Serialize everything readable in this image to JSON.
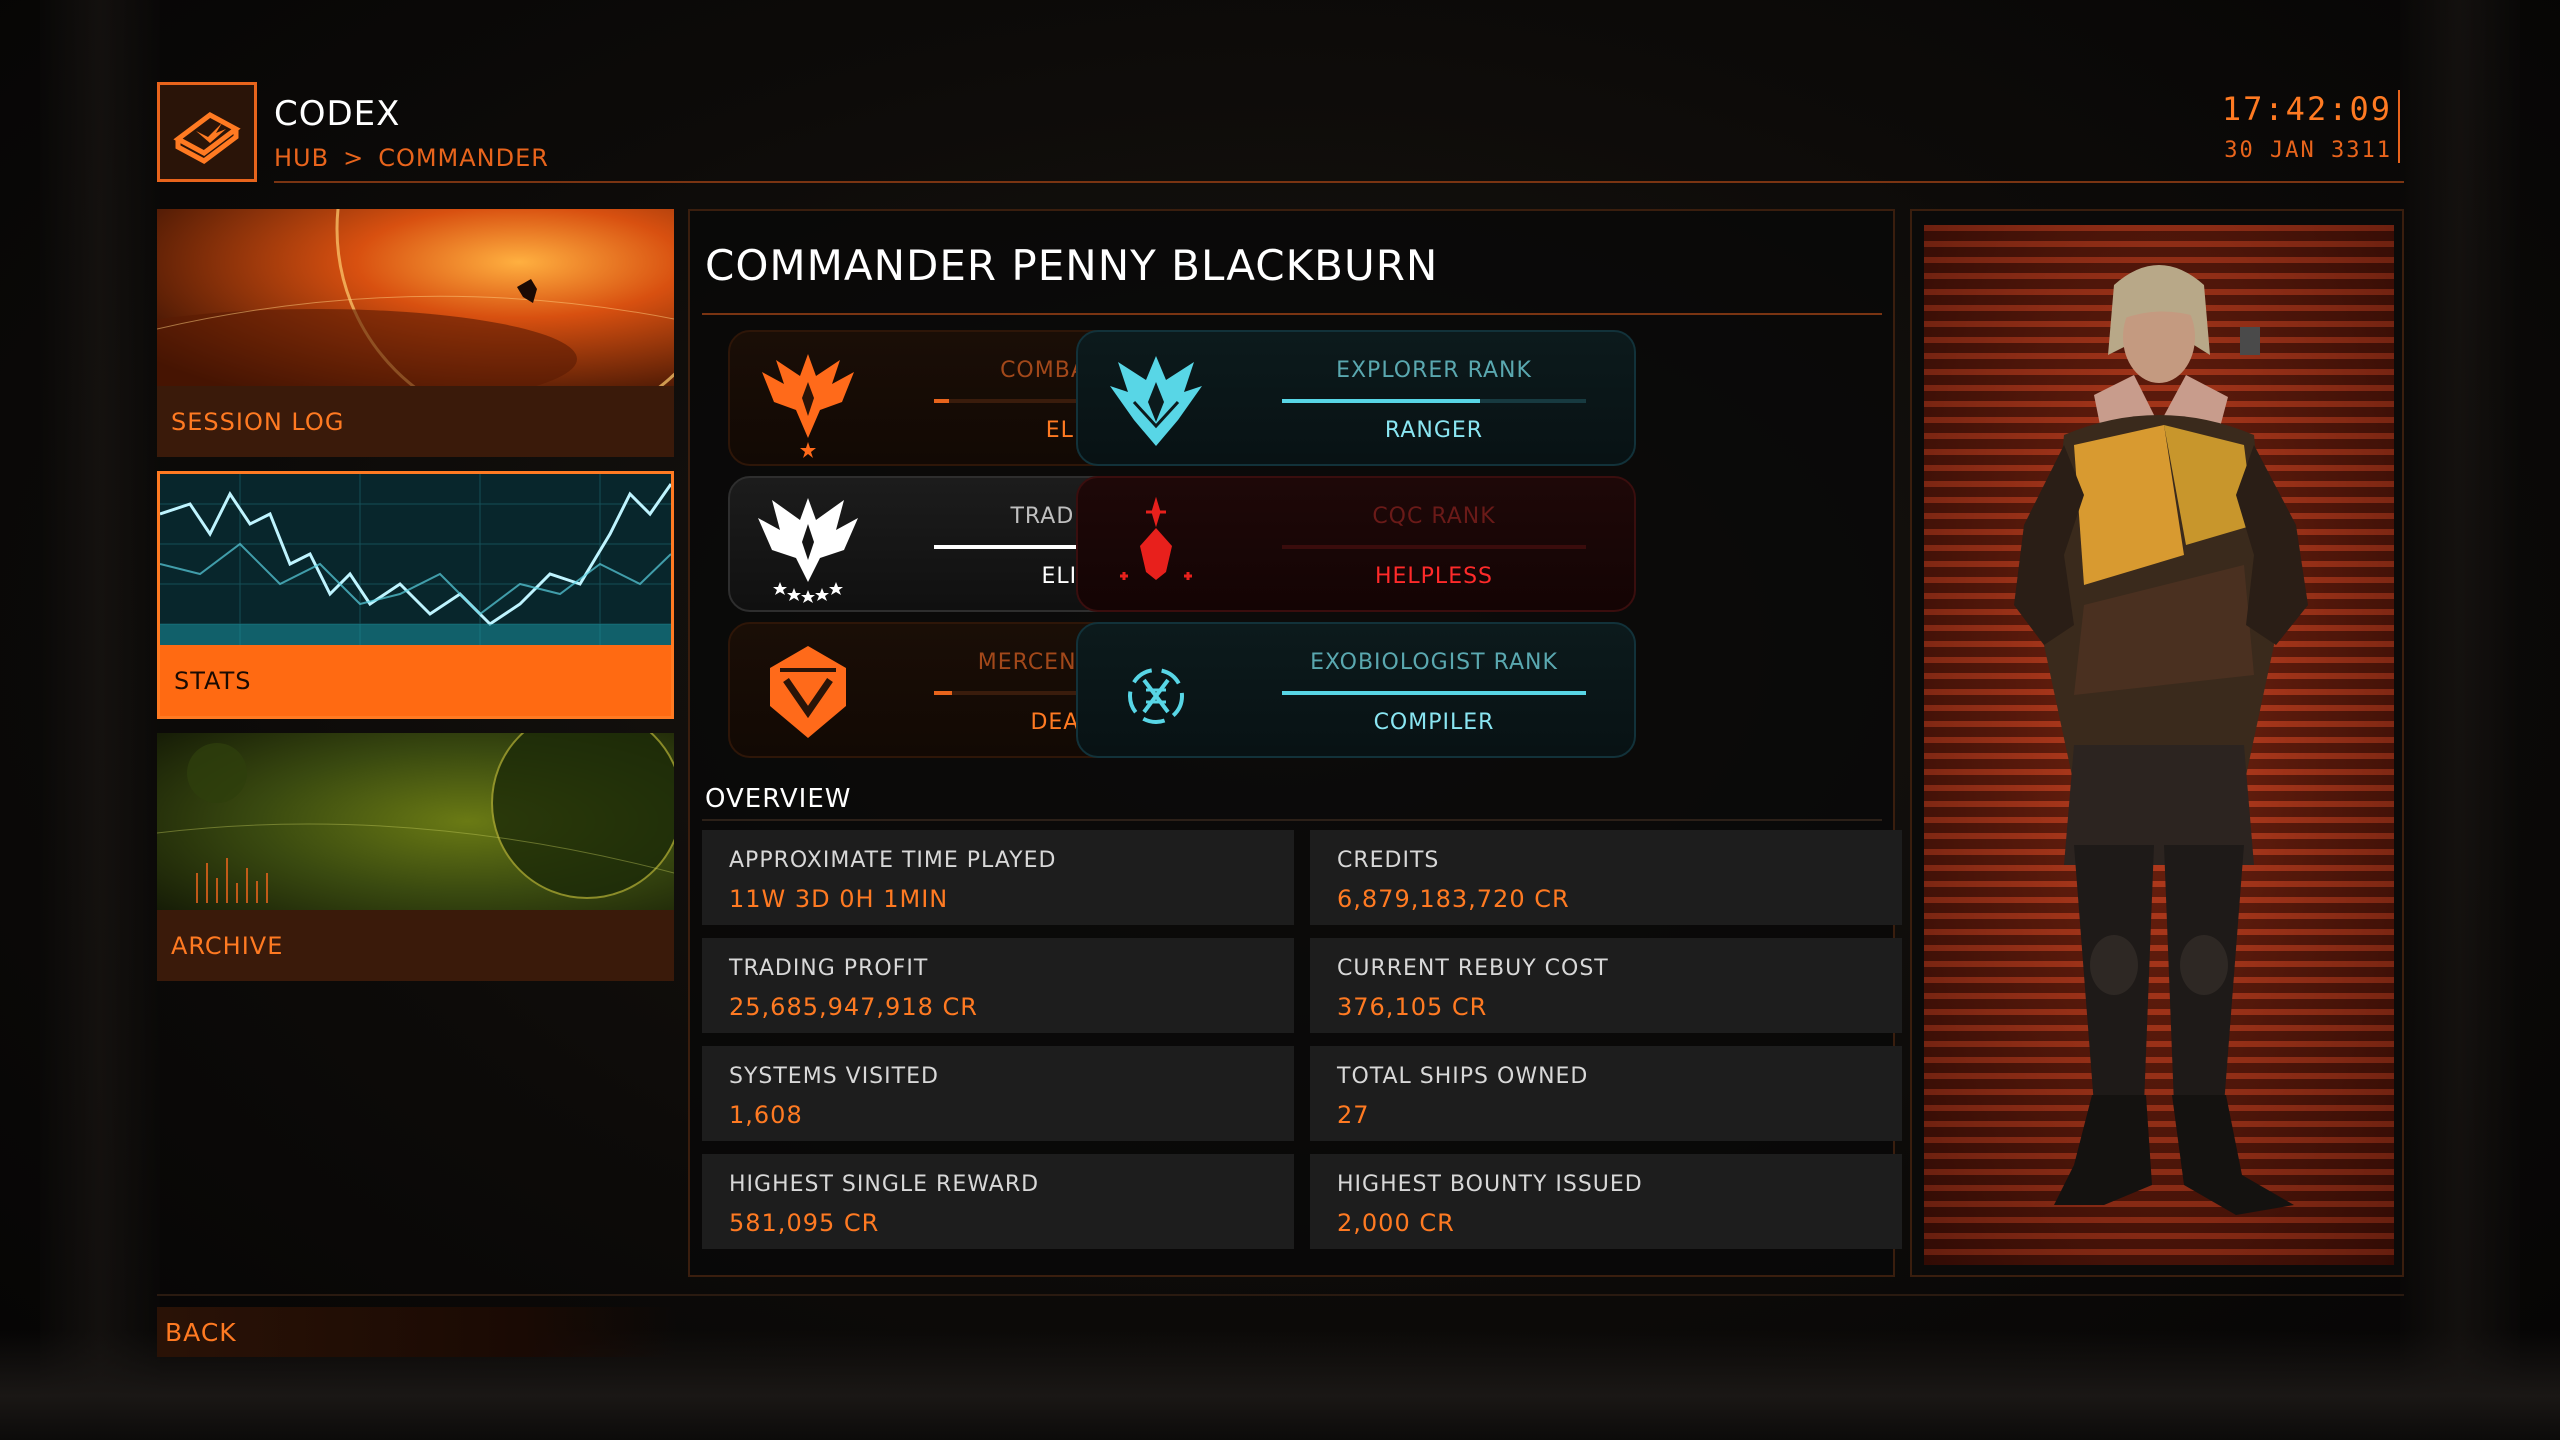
{
  "header": {
    "app_title": "CODEX",
    "breadcrumb": [
      "HUB",
      ">",
      "COMMANDER"
    ],
    "time": "17:42:09",
    "date": "30 JAN 3311",
    "logo_icon": "codex-book-icon"
  },
  "nav": [
    {
      "label": "SESSION LOG",
      "active": false
    },
    {
      "label": "STATS",
      "active": true
    },
    {
      "label": "ARCHIVE",
      "active": false
    }
  ],
  "commander_name": "COMMANDER PENNY BLACKBURN",
  "ranks": [
    {
      "title": "COMBAT RANK",
      "value": "ELITE I",
      "progress": 0.05,
      "theme": "orange",
      "icon": "combat-elite-emblem-icon"
    },
    {
      "title": "EXPLORER RANK",
      "value": "RANGER",
      "progress": 0.65,
      "theme": "cyan",
      "icon": "explorer-emblem-icon"
    },
    {
      "title": "TRADE RANK",
      "value": "ELITE V",
      "progress": 1.0,
      "theme": "white",
      "icon": "trade-elite-emblem-icon"
    },
    {
      "title": "CQC RANK",
      "value": "HELPLESS",
      "progress": 0.0,
      "theme": "red",
      "icon": "cqc-emblem-icon"
    },
    {
      "title": "MERCENARY RANK",
      "value": "DEADEYE",
      "progress": 0.06,
      "theme": "orange",
      "icon": "mercenary-emblem-icon"
    },
    {
      "title": "EXOBIOLOGIST RANK",
      "value": "COMPILER",
      "progress": 1.0,
      "theme": "cyan",
      "icon": "exobiologist-emblem-icon"
    }
  ],
  "overview": {
    "title": "OVERVIEW",
    "stats": [
      {
        "label": "APPROXIMATE TIME PLAYED",
        "value": "11W 3D 0H 1MIN"
      },
      {
        "label": "CREDITS",
        "value": "6,879,183,720 CR"
      },
      {
        "label": "TRADING PROFIT",
        "value": "25,685,947,918 CR"
      },
      {
        "label": "CURRENT REBUY COST",
        "value": "376,105 CR"
      },
      {
        "label": "SYSTEMS VISITED",
        "value": "1,608"
      },
      {
        "label": "TOTAL SHIPS OWNED",
        "value": "27"
      },
      {
        "label": "HIGHEST SINGLE REWARD",
        "value": "581,095 CR"
      },
      {
        "label": "HIGHEST BOUNTY ISSUED",
        "value": "2,000 CR"
      }
    ]
  },
  "back_label": "BACK",
  "colors": {
    "accent": "#ff7a22",
    "cyan": "#58d6e6",
    "red": "#ff2a2a"
  }
}
